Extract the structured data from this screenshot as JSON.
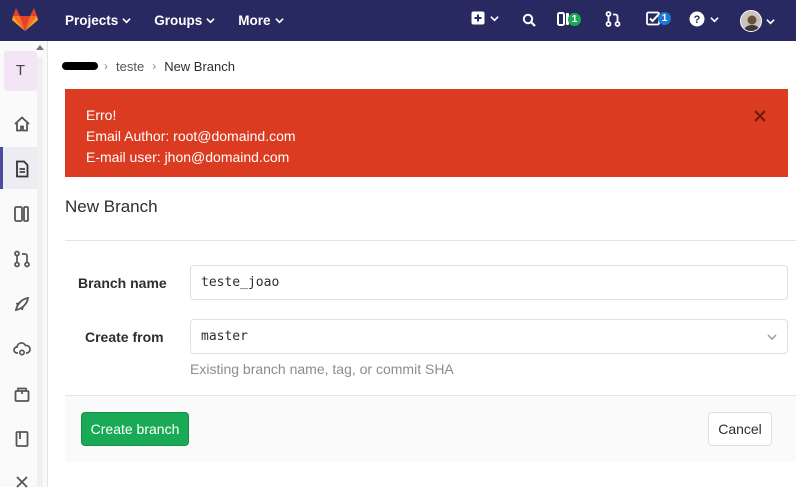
{
  "navbar": {
    "logo_icon": "gitlab-tanuki-icon",
    "menu": [
      {
        "label": "Projects"
      },
      {
        "label": "Groups"
      },
      {
        "label": "More"
      }
    ],
    "issues_count": "1",
    "todos_count": "1",
    "colors": {
      "background": "#292961",
      "issues_badge": "#1aaa55",
      "todos_badge": "#1f78d1"
    }
  },
  "sidebar": {
    "project_initial": "T",
    "items": [
      {
        "icon": "home-icon"
      },
      {
        "icon": "file-document-icon",
        "active": true
      },
      {
        "icon": "issues-icon"
      },
      {
        "icon": "merge-request-icon"
      },
      {
        "icon": "rocket-icon"
      },
      {
        "icon": "cloud-gear-icon"
      },
      {
        "icon": "package-icon"
      },
      {
        "icon": "book-icon"
      },
      {
        "icon": "collapse-icon"
      }
    ]
  },
  "breadcrumb": {
    "project": "teste",
    "current": "New Branch"
  },
  "alert": {
    "line1": "Erro!",
    "line2": "Email Author: root@domaind.com",
    "line3": "E-mail user: jhon@domaind.com",
    "color": "#db3b21"
  },
  "page": {
    "title": "New Branch"
  },
  "form": {
    "branch_name_label": "Branch name",
    "branch_name_value": "teste_joao",
    "create_from_label": "Create from",
    "create_from_value": "master",
    "help_text": "Existing branch name, tag, or commit SHA"
  },
  "actions": {
    "create_label": "Create branch",
    "cancel_label": "Cancel",
    "create_color": "#1aaa55"
  }
}
